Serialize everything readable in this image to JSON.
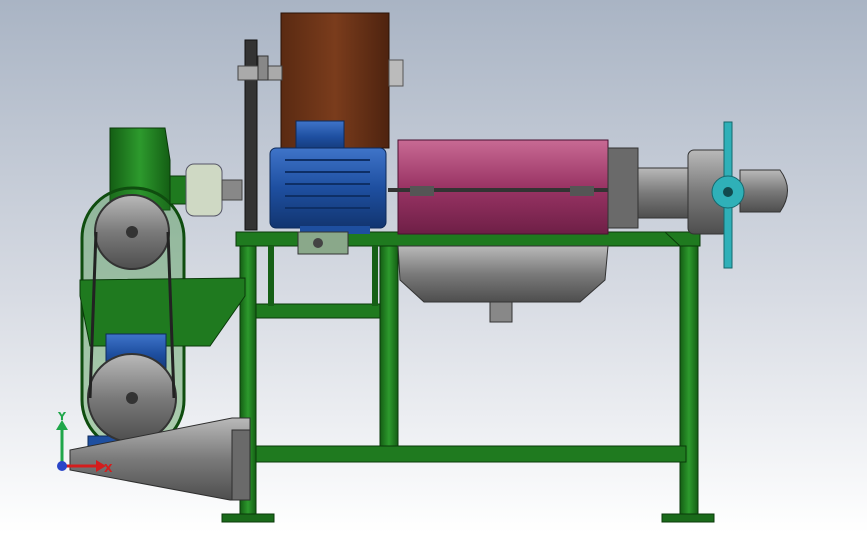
{
  "triad": {
    "y_label": "Y",
    "x_label": "X",
    "y_color": "#1fa64a",
    "x_color": "#d41d1d",
    "z_color": "#2a45c8"
  },
  "colors": {
    "frame_green": "#1f7a1f",
    "frame_dark": "#0f4d0f",
    "hopper_brown": "#6b3418",
    "barrel_magenta": "#9c3b6a",
    "motor_blue": "#1e4fa0",
    "steel_grey": "#7c7c7c",
    "cyan_handwheel": "#2fb0b8"
  }
}
